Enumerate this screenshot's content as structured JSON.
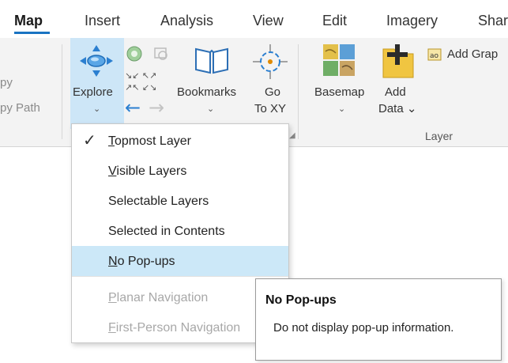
{
  "tabs": [
    {
      "label": "Map",
      "active": true
    },
    {
      "label": "Insert"
    },
    {
      "label": "Analysis"
    },
    {
      "label": "View"
    },
    {
      "label": "Edit"
    },
    {
      "label": "Imagery"
    },
    {
      "label": "Shar"
    }
  ],
  "ribbon": {
    "clipped_left": {
      "line1": "py",
      "line2": "py Path"
    },
    "explore": {
      "label": "Explore",
      "icon": "pan-arrows-icon",
      "chevron": "⌄"
    },
    "bookmarks": {
      "label": "Bookmarks",
      "icon": "book-icon",
      "chevron": "⌄"
    },
    "goto": {
      "line1": "Go",
      "line2": "To XY",
      "icon": "crosshair-icon"
    },
    "basemap": {
      "label": "Basemap",
      "icon": "basemap-grid-icon",
      "chevron": "⌄"
    },
    "add_data": {
      "line1": "Add",
      "line2": "Data ⌄",
      "icon": "add-data-icon"
    },
    "add_graphics": {
      "label": "Add Grap",
      "icon": "graphics-layer-icon"
    },
    "group_layer_label": "Layer"
  },
  "menu": {
    "items": [
      {
        "ak": "T",
        "rest": "opmost Layer",
        "checked": true
      },
      {
        "ak": "V",
        "rest": "isible Layers"
      },
      {
        "ak": "",
        "rest": "Selectable Layers"
      },
      {
        "ak": "",
        "rest": "Selected in Contents"
      },
      {
        "ak": "N",
        "rest": "o Pop-ups",
        "highlighted": true
      },
      {
        "ak": "P",
        "rest": "lanar Navigation",
        "disabled": true
      },
      {
        "ak": "F",
        "rest": "irst-Person Navigation",
        "disabled": true
      }
    ]
  },
  "tooltip": {
    "title": "No Pop-ups",
    "body": "Do not display pop-up information."
  },
  "colors": {
    "accent": "#1a73c2",
    "hover_bg": "#cce8f8",
    "explore_bg": "#cde6f7",
    "disabled_text": "#a8a8a8"
  }
}
